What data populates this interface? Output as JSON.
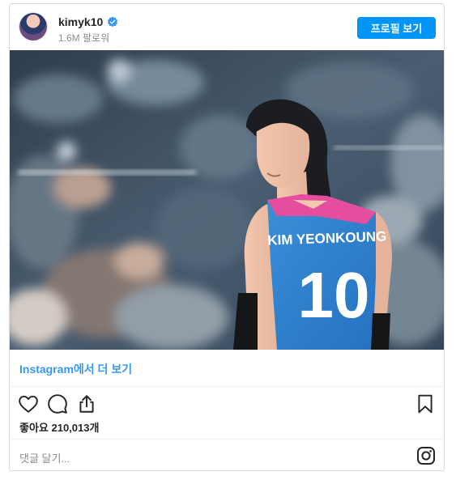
{
  "header": {
    "username": "kimyk10",
    "followers": "1.6M 팔로워",
    "profile_button": "프로필 보기"
  },
  "photo": {
    "jersey_name": "KIM YEONKOUNG",
    "jersey_number": "10"
  },
  "more_link": "Instagram에서 더 보기",
  "actions": {
    "icons": [
      "heart-icon",
      "comment-icon",
      "share-icon",
      "bookmark-icon"
    ]
  },
  "likes": "좋아요 210,013개",
  "comment": {
    "placeholder": "댓글 달기..."
  },
  "colors": {
    "accent": "#0095f6",
    "link": "#3897f0"
  }
}
